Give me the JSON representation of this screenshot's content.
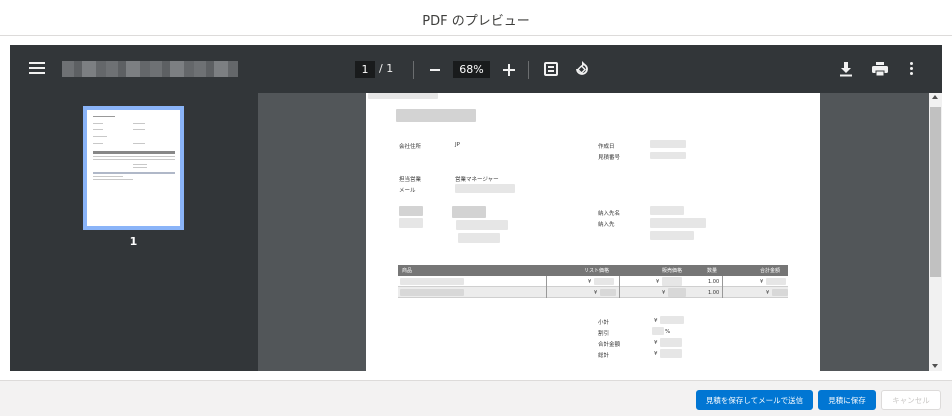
{
  "modal": {
    "title": "PDF のプレビュー"
  },
  "toolbar": {
    "page_current": "1",
    "page_total": "/ 1",
    "zoom": "68%",
    "icons": [
      "menu-icon",
      "zoom-out-icon",
      "zoom-in-icon",
      "fit-page-icon",
      "rotate-icon",
      "download-icon",
      "print-icon",
      "more-icon"
    ]
  },
  "thumbnails": [
    {
      "label": "1"
    }
  ],
  "document": {
    "company_address_label": "会社住所",
    "country": "JP",
    "created_date_label": "作成日",
    "quote_number_label": "見積番号",
    "sales_rep_label": "担当営業",
    "sales_rep_title": "営業マネージャー",
    "email_label": "メール",
    "ship_to_name_label": "納入先名",
    "ship_to_label": "納入先",
    "table": {
      "headers": [
        "商品",
        "リスト価格",
        "販売価格",
        "数量",
        "合計金額"
      ],
      "rows": [
        {
          "currency_list": "¥",
          "currency_sale": "¥",
          "quantity": "1.00",
          "currency_total": "¥"
        },
        {
          "currency_list": "¥",
          "currency_sale": "¥",
          "quantity": "1.00",
          "currency_total": "¥"
        }
      ]
    },
    "totals": {
      "subtotal_label": "小計",
      "subtotal_currency": "¥",
      "discount_label": "割引",
      "discount_unit": "%",
      "grand_total_label": "合計金額",
      "grand_total_currency": "¥",
      "total_label": "総計",
      "total_currency": "¥"
    }
  },
  "footer": {
    "save_and_email_label": "見積を保存してメールで送信",
    "save_label": "見積に保存",
    "cancel_label": "キャンセル"
  },
  "colors": {
    "brand_blue": "#0176d3",
    "toolbar": "#323639",
    "viewer_bg": "#525659",
    "thumb_highlight": "#8ab4f8"
  }
}
